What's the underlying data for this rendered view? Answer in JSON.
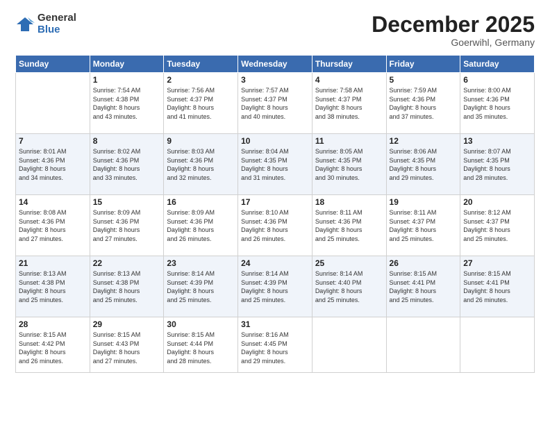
{
  "logo": {
    "general": "General",
    "blue": "Blue"
  },
  "header": {
    "month": "December 2025",
    "location": "Goerwihl, Germany"
  },
  "days_of_week": [
    "Sunday",
    "Monday",
    "Tuesday",
    "Wednesday",
    "Thursday",
    "Friday",
    "Saturday"
  ],
  "weeks": [
    [
      {
        "day": "",
        "info": ""
      },
      {
        "day": "1",
        "info": "Sunrise: 7:54 AM\nSunset: 4:38 PM\nDaylight: 8 hours\nand 43 minutes."
      },
      {
        "day": "2",
        "info": "Sunrise: 7:56 AM\nSunset: 4:37 PM\nDaylight: 8 hours\nand 41 minutes."
      },
      {
        "day": "3",
        "info": "Sunrise: 7:57 AM\nSunset: 4:37 PM\nDaylight: 8 hours\nand 40 minutes."
      },
      {
        "day": "4",
        "info": "Sunrise: 7:58 AM\nSunset: 4:37 PM\nDaylight: 8 hours\nand 38 minutes."
      },
      {
        "day": "5",
        "info": "Sunrise: 7:59 AM\nSunset: 4:36 PM\nDaylight: 8 hours\nand 37 minutes."
      },
      {
        "day": "6",
        "info": "Sunrise: 8:00 AM\nSunset: 4:36 PM\nDaylight: 8 hours\nand 35 minutes."
      }
    ],
    [
      {
        "day": "7",
        "info": "Sunrise: 8:01 AM\nSunset: 4:36 PM\nDaylight: 8 hours\nand 34 minutes."
      },
      {
        "day": "8",
        "info": "Sunrise: 8:02 AM\nSunset: 4:36 PM\nDaylight: 8 hours\nand 33 minutes."
      },
      {
        "day": "9",
        "info": "Sunrise: 8:03 AM\nSunset: 4:36 PM\nDaylight: 8 hours\nand 32 minutes."
      },
      {
        "day": "10",
        "info": "Sunrise: 8:04 AM\nSunset: 4:35 PM\nDaylight: 8 hours\nand 31 minutes."
      },
      {
        "day": "11",
        "info": "Sunrise: 8:05 AM\nSunset: 4:35 PM\nDaylight: 8 hours\nand 30 minutes."
      },
      {
        "day": "12",
        "info": "Sunrise: 8:06 AM\nSunset: 4:35 PM\nDaylight: 8 hours\nand 29 minutes."
      },
      {
        "day": "13",
        "info": "Sunrise: 8:07 AM\nSunset: 4:35 PM\nDaylight: 8 hours\nand 28 minutes."
      }
    ],
    [
      {
        "day": "14",
        "info": "Sunrise: 8:08 AM\nSunset: 4:36 PM\nDaylight: 8 hours\nand 27 minutes."
      },
      {
        "day": "15",
        "info": "Sunrise: 8:09 AM\nSunset: 4:36 PM\nDaylight: 8 hours\nand 27 minutes."
      },
      {
        "day": "16",
        "info": "Sunrise: 8:09 AM\nSunset: 4:36 PM\nDaylight: 8 hours\nand 26 minutes."
      },
      {
        "day": "17",
        "info": "Sunrise: 8:10 AM\nSunset: 4:36 PM\nDaylight: 8 hours\nand 26 minutes."
      },
      {
        "day": "18",
        "info": "Sunrise: 8:11 AM\nSunset: 4:36 PM\nDaylight: 8 hours\nand 25 minutes."
      },
      {
        "day": "19",
        "info": "Sunrise: 8:11 AM\nSunset: 4:37 PM\nDaylight: 8 hours\nand 25 minutes."
      },
      {
        "day": "20",
        "info": "Sunrise: 8:12 AM\nSunset: 4:37 PM\nDaylight: 8 hours\nand 25 minutes."
      }
    ],
    [
      {
        "day": "21",
        "info": "Sunrise: 8:13 AM\nSunset: 4:38 PM\nDaylight: 8 hours\nand 25 minutes."
      },
      {
        "day": "22",
        "info": "Sunrise: 8:13 AM\nSunset: 4:38 PM\nDaylight: 8 hours\nand 25 minutes."
      },
      {
        "day": "23",
        "info": "Sunrise: 8:14 AM\nSunset: 4:39 PM\nDaylight: 8 hours\nand 25 minutes."
      },
      {
        "day": "24",
        "info": "Sunrise: 8:14 AM\nSunset: 4:39 PM\nDaylight: 8 hours\nand 25 minutes."
      },
      {
        "day": "25",
        "info": "Sunrise: 8:14 AM\nSunset: 4:40 PM\nDaylight: 8 hours\nand 25 minutes."
      },
      {
        "day": "26",
        "info": "Sunrise: 8:15 AM\nSunset: 4:41 PM\nDaylight: 8 hours\nand 25 minutes."
      },
      {
        "day": "27",
        "info": "Sunrise: 8:15 AM\nSunset: 4:41 PM\nDaylight: 8 hours\nand 26 minutes."
      }
    ],
    [
      {
        "day": "28",
        "info": "Sunrise: 8:15 AM\nSunset: 4:42 PM\nDaylight: 8 hours\nand 26 minutes."
      },
      {
        "day": "29",
        "info": "Sunrise: 8:15 AM\nSunset: 4:43 PM\nDaylight: 8 hours\nand 27 minutes."
      },
      {
        "day": "30",
        "info": "Sunrise: 8:15 AM\nSunset: 4:44 PM\nDaylight: 8 hours\nand 28 minutes."
      },
      {
        "day": "31",
        "info": "Sunrise: 8:16 AM\nSunset: 4:45 PM\nDaylight: 8 hours\nand 29 minutes."
      },
      {
        "day": "",
        "info": ""
      },
      {
        "day": "",
        "info": ""
      },
      {
        "day": "",
        "info": ""
      }
    ]
  ]
}
